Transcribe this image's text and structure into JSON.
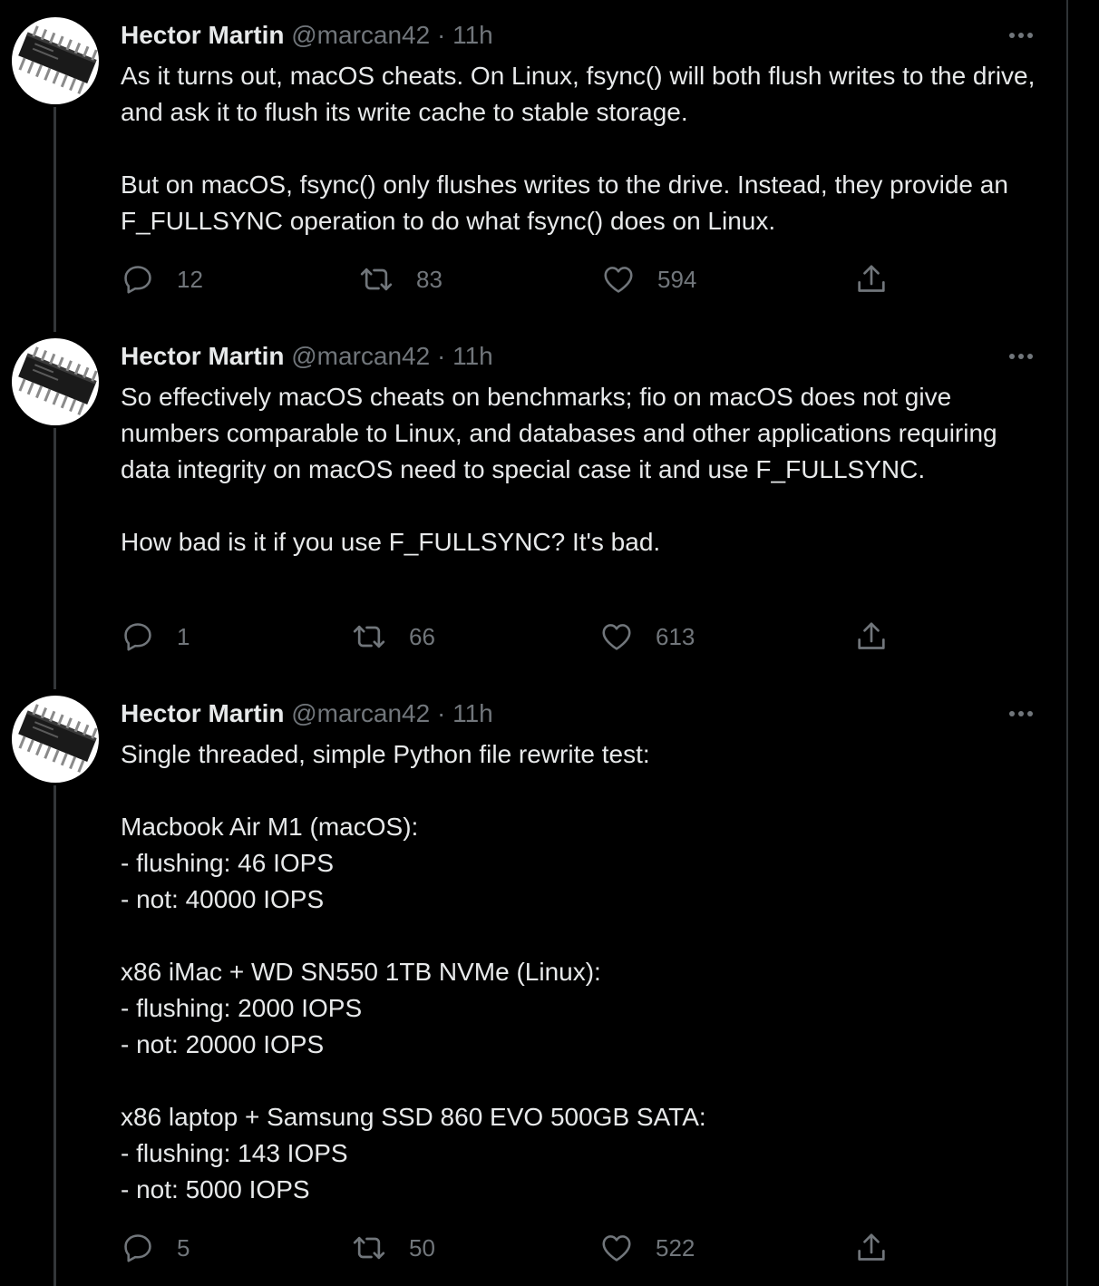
{
  "tweets": [
    {
      "name": "Hector Martin",
      "handle": "@marcan42",
      "separator": "·",
      "time": "11h",
      "paragraphs": [
        "As it turns out, macOS cheats. On Linux, fsync() will both flush writes to the drive, and ask it to flush its write cache to stable storage.",
        "But on macOS, fsync() only flushes writes to the drive. Instead, they provide an F_FULLSYNC operation to do what fsync() does on Linux."
      ],
      "replies": "12",
      "retweets": "83",
      "likes": "594"
    },
    {
      "name": "Hector Martin",
      "handle": "@marcan42",
      "separator": "·",
      "time": "11h",
      "paragraphs": [
        "So effectively macOS cheats on benchmarks; fio on macOS does not give numbers comparable to Linux, and databases and other applications requiring data integrity on macOS need to special case it and use F_FULLSYNC.",
        "How bad is it if you use F_FULLSYNC? It's bad."
      ],
      "replies": "1",
      "retweets": "66",
      "likes": "613"
    },
    {
      "name": "Hector Martin",
      "handle": "@marcan42",
      "separator": "·",
      "time": "11h",
      "paragraphs": [
        "Single threaded, simple Python file rewrite test:",
        "Macbook Air M1 (macOS):\n- flushing: 46 IOPS\n- not: 40000 IOPS",
        "x86 iMac + WD SN550 1TB NVMe (Linux):\n- flushing: 2000 IOPS\n- not: 20000 IOPS",
        "x86 laptop + Samsung SSD 860 EVO 500GB SATA:\n- flushing: 143 IOPS\n- not: 5000 IOPS"
      ],
      "replies": "5",
      "retweets": "50",
      "likes": "522"
    }
  ],
  "icons": {
    "reply": "reply-icon",
    "retweet": "retweet-icon",
    "like": "heart-icon",
    "share": "share-icon",
    "more": "more-icon"
  },
  "colors": {
    "background": "#000000",
    "text": "#e7e9ea",
    "secondary": "#71767b",
    "thread_line": "#333639"
  }
}
